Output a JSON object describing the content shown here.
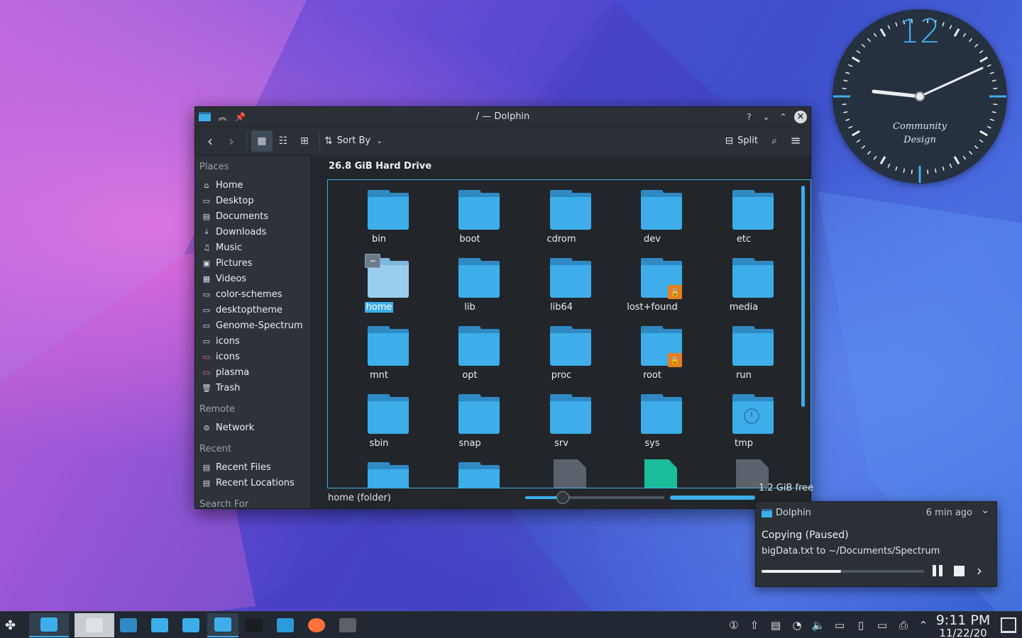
{
  "colors": {
    "accent": "#3daee9",
    "folder": "#3daee9",
    "lock": "#e67e22",
    "window_bg": "#2a2e34"
  },
  "clock_widget": {
    "hour_number": "12",
    "brand_line1": "Community",
    "brand_line2": "Design",
    "hour_hand": "9 o'clock",
    "minute_hand": "11 minutes"
  },
  "window": {
    "title": "/ — Dolphin",
    "titlebar_buttons": [
      "help-icon",
      "minimize-icon",
      "maximize-icon",
      "close-icon"
    ]
  },
  "toolbar": {
    "sort_label": "Sort By",
    "split_label": "Split"
  },
  "sidebar": {
    "places_header": "Places",
    "places": [
      {
        "label": "Home",
        "icon": "home-icon"
      },
      {
        "label": "Desktop",
        "icon": "desktop-icon"
      },
      {
        "label": "Documents",
        "icon": "documents-icon"
      },
      {
        "label": "Downloads",
        "icon": "downloads-icon"
      },
      {
        "label": "Music",
        "icon": "music-icon"
      },
      {
        "label": "Pictures",
        "icon": "pictures-icon"
      },
      {
        "label": "Videos",
        "icon": "videos-icon"
      },
      {
        "label": "color-schemes",
        "icon": "folder-icon"
      },
      {
        "label": "desktoptheme",
        "icon": "folder-icon"
      },
      {
        "label": "Genome-Spectrum",
        "icon": "folder-icon"
      },
      {
        "label": "icons",
        "icon": "folder-icon"
      },
      {
        "label": "icons",
        "icon": "folder-red-icon"
      },
      {
        "label": "plasma",
        "icon": "folder-red-icon"
      },
      {
        "label": "Trash",
        "icon": "trash-icon"
      }
    ],
    "remote_header": "Remote",
    "remote": [
      {
        "label": "Network",
        "icon": "network-icon"
      }
    ],
    "recent_header": "Recent",
    "recent": [
      {
        "label": "Recent Files",
        "icon": "recent-files-icon"
      },
      {
        "label": "Recent Locations",
        "icon": "recent-locations-icon"
      }
    ],
    "search_header": "Search For"
  },
  "main": {
    "location_label": "26.8 GiB Hard Drive",
    "items": [
      {
        "name": "bin",
        "kind": "folder"
      },
      {
        "name": "boot",
        "kind": "folder"
      },
      {
        "name": "cdrom",
        "kind": "folder"
      },
      {
        "name": "dev",
        "kind": "folder"
      },
      {
        "name": "etc",
        "kind": "folder"
      },
      {
        "name": "home",
        "kind": "folder",
        "selected": true
      },
      {
        "name": "lib",
        "kind": "folder"
      },
      {
        "name": "lib64",
        "kind": "folder"
      },
      {
        "name": "lost+found",
        "kind": "folder-locked"
      },
      {
        "name": "media",
        "kind": "folder"
      },
      {
        "name": "mnt",
        "kind": "folder"
      },
      {
        "name": "opt",
        "kind": "folder"
      },
      {
        "name": "proc",
        "kind": "folder"
      },
      {
        "name": "root",
        "kind": "folder-locked"
      },
      {
        "name": "run",
        "kind": "folder"
      },
      {
        "name": "sbin",
        "kind": "folder"
      },
      {
        "name": "snap",
        "kind": "folder"
      },
      {
        "name": "srv",
        "kind": "folder"
      },
      {
        "name": "sys",
        "kind": "folder"
      },
      {
        "name": "tmp",
        "kind": "folder-temp"
      },
      {
        "name": "",
        "kind": "folder"
      },
      {
        "name": "",
        "kind": "folder"
      },
      {
        "name": "",
        "kind": "file-disc"
      },
      {
        "name": "",
        "kind": "file-recycle"
      },
      {
        "name": "",
        "kind": "file-unknown"
      }
    ]
  },
  "statusbar": {
    "text": "home (folder)",
    "zoom_fraction": 0.27,
    "free_space": "1.2 GiB free"
  },
  "notification": {
    "app": "Dolphin",
    "time": "6 min ago",
    "title": "Copying (Paused)",
    "body": "bigData.txt to ~/Documents/Spectrum",
    "progress": 0.49
  },
  "taskbar": {
    "tasks": [
      "app-launcher-icon",
      "dolphin-icon",
      "terminal-icon",
      "system-settings-icon",
      "discover-icon",
      "dolphin-icon",
      "dolphin-icon",
      "inkscape-icon",
      "browser-icon",
      "firefox-icon",
      "konsole-icon"
    ],
    "tray": [
      "updates-icon",
      "vault-icon",
      "clipboard-icon",
      "night-color-icon",
      "volume-icon",
      "network-disconnected-icon",
      "battery-icon",
      "kdeconnect-icon",
      "printer-icon",
      "tray-expand-icon"
    ],
    "time": "9:11 PM",
    "date": "11/22/20"
  }
}
